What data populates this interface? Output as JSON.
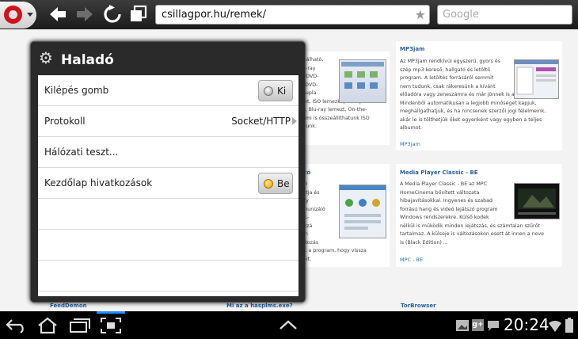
{
  "browser": {
    "url": "csillagpor.hu/remek/",
    "search_placeholder": "Google"
  },
  "page": {
    "card1": {
      "text": [
        "sználható,",
        "Blu-ray",
        "W, DVD-",
        "és DVD-",
        "a dupla",
        "letet, ISO lemezképet, mp3",
        "D-t, Blu-ray lemezt, On-the-",
        "de mi is összeállíthatunk ISO",
        "hatunk."
      ]
    },
    "card2": {
      "title": "MP3jam",
      "text": [
        "Az MP3jam rendkívül egyszerű, gyors és",
        "szép mp3 kereső, hallgató és letöltő",
        "program. A letöltés forrásáról semmit",
        "nem tudunk, csak rákeresünk a kívánt",
        "előadóra vagy zeneszámra és már jönnek is a találatok.",
        "Mindenből automatikusan a legjobb minőséget kapjuk,",
        "meghallgathatjuk, és ha nincsenek szerzői jogi félelmeink,",
        "akár le is tölthetjük őket egyenként vagy egyben a teljes",
        "albumot."
      ],
      "link": "MP3jam"
    },
    "card3": {
      "title": "ltító",
      "text": [
        "ltító",
        "utatja és",
        "istry",
        "mmunizáló",
        "URL-",
        "hozzá",
        "isen",
        "változás",
        "ezít a program, hogy vissza",
        "esait."
      ]
    },
    "card4": {
      "title": "Media Player Classic - BE",
      "text": [
        "A Media Player Classic - BE az MPC",
        "HomeCinema bővített változata",
        "hibajavításokkal. Ingyenes és szabad",
        "forrású hang és videó lejátszó program",
        "Windows rendszerekre. Külső kodek",
        "nélkül is működik minden lejátszás, és számtalan szűrőt",
        "tartalmaz. A külseje is változásokon esett át innen a neve",
        "is (Black Edition) ..."
      ],
      "link": "MPC - BE"
    },
    "bottom_titles": [
      "FeedDemon",
      "Mi az a hasplms.exe?",
      "TorBrowser"
    ]
  },
  "popup": {
    "title": "Haladó",
    "rows": [
      {
        "label": "Kilépés gomb",
        "toggle": "Ki",
        "state": "off"
      },
      {
        "label": "Protokoll",
        "value": "Socket/HTTP"
      },
      {
        "label": "Hálózati teszt..."
      },
      {
        "label": "Kezdőlap hivatkozások",
        "toggle": "Be",
        "state": "on"
      }
    ]
  },
  "sysbar": {
    "time": "20:24"
  },
  "icons": [
    "opera-menu-icon",
    "back-arrow-icon",
    "forward-arrow-icon",
    "reload-icon",
    "tabs-icon",
    "bookmark-star-icon",
    "gear-icon",
    "back-nav-icon",
    "home-icon",
    "recent-apps-icon",
    "screenshot-icon",
    "up-chevron-icon",
    "gallery-icon",
    "google-plus-icon",
    "chat-icon",
    "wifi-icon",
    "battery-icon"
  ]
}
